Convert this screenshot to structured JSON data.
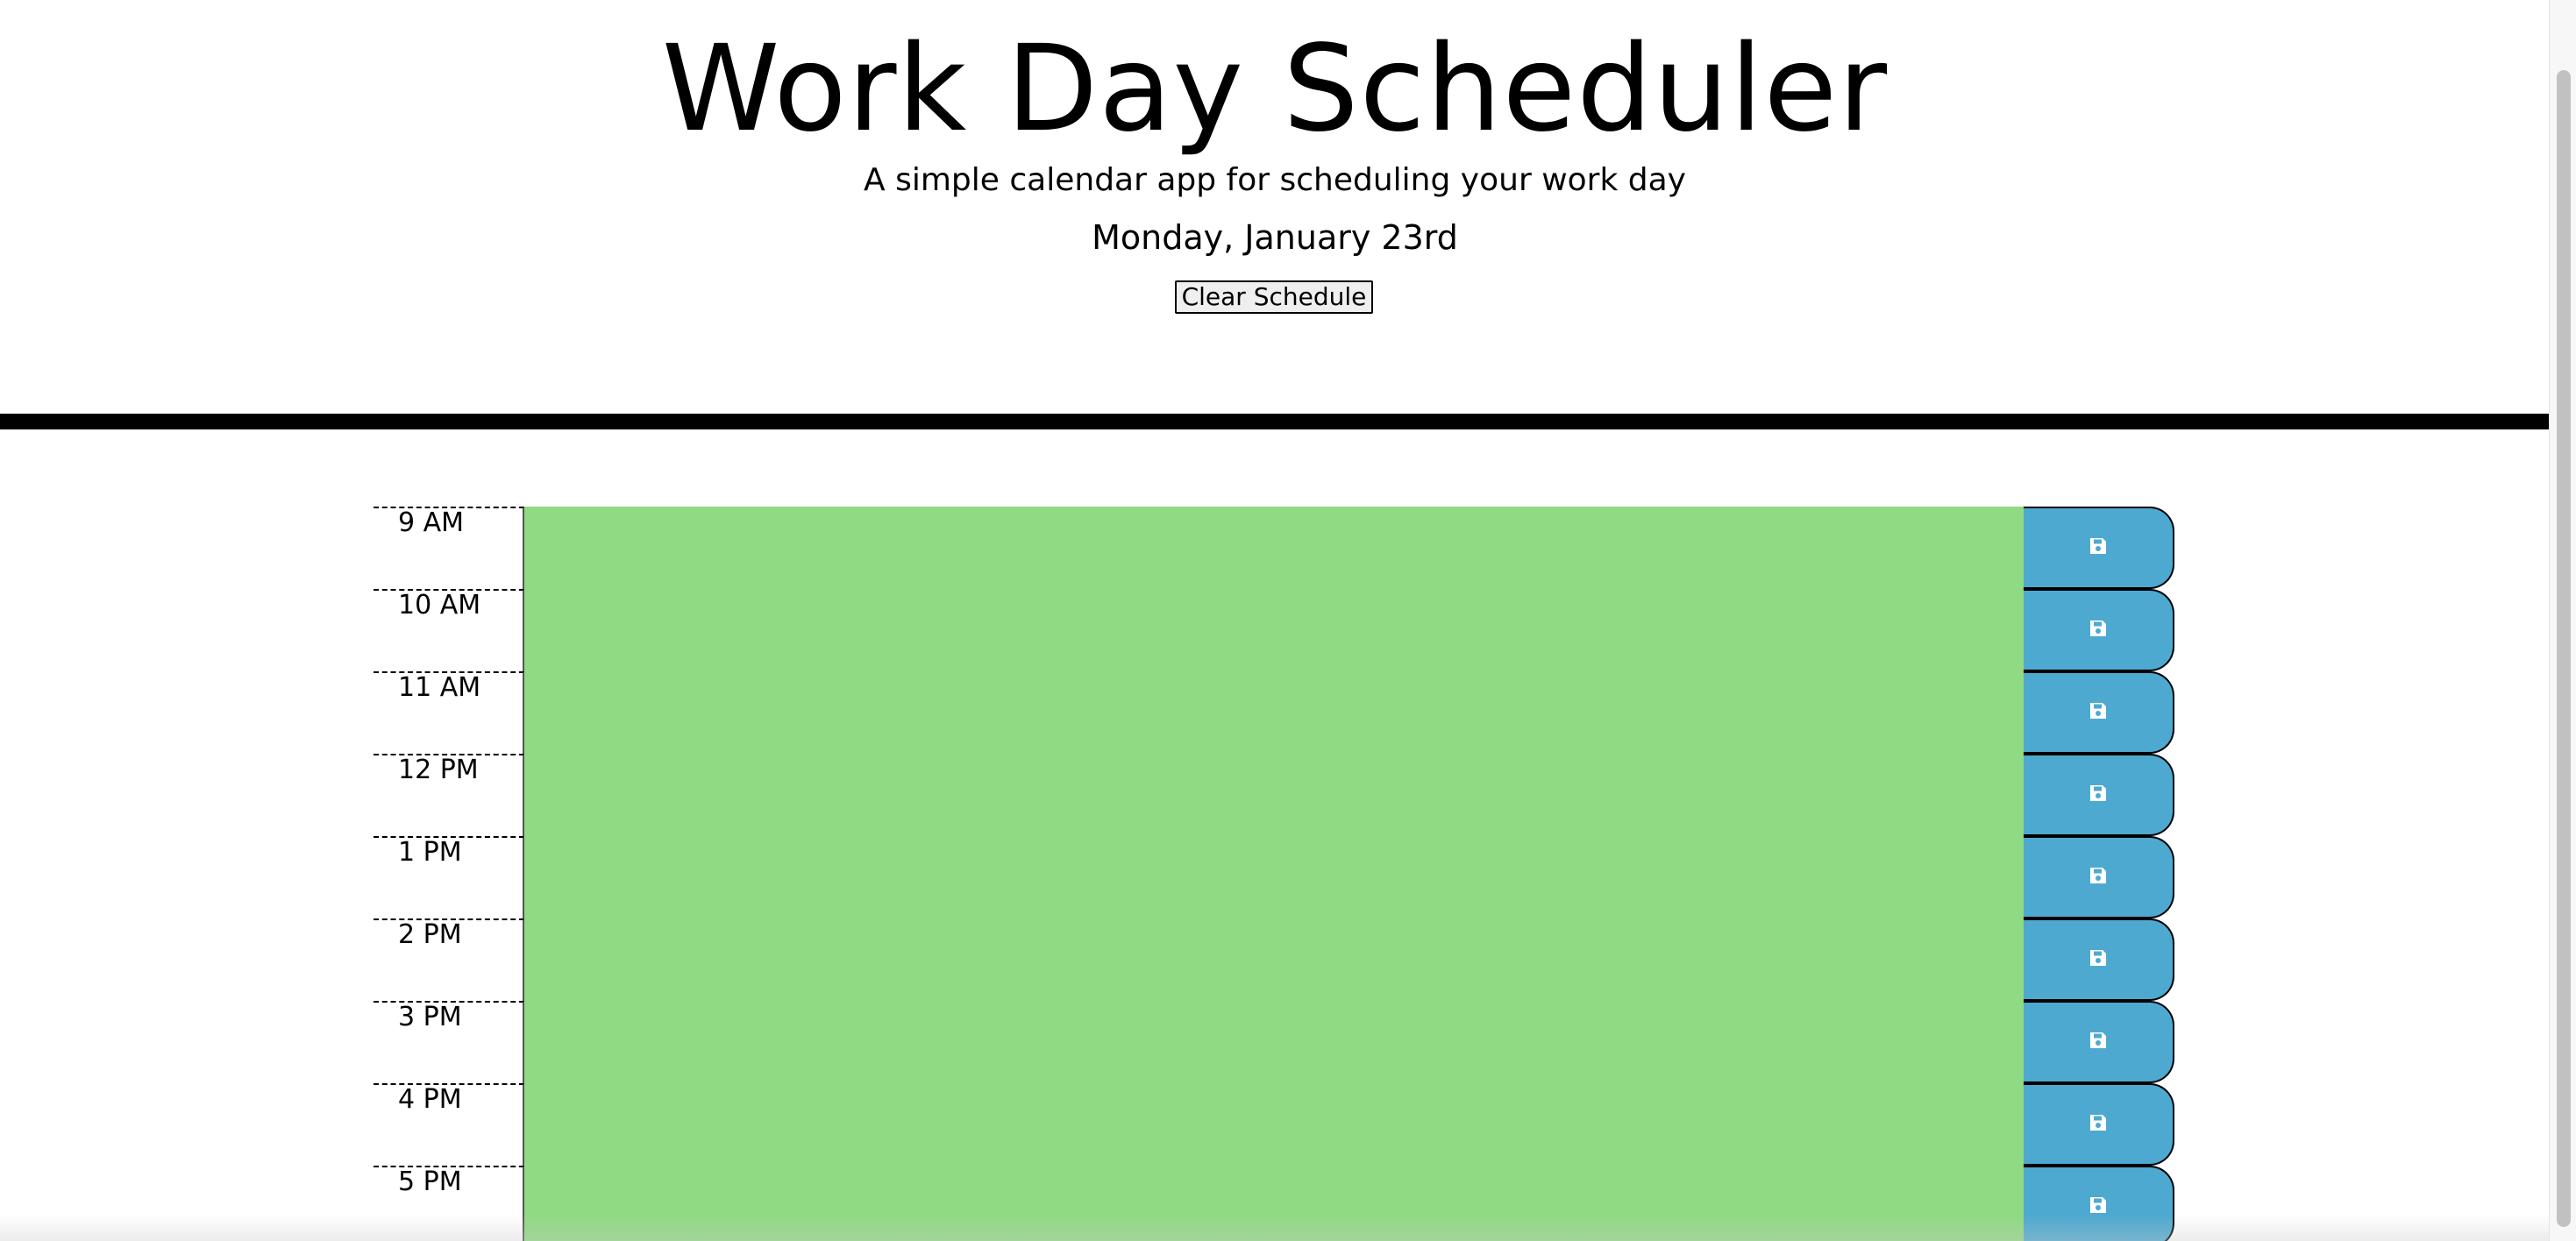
{
  "header": {
    "title": "Work Day Scheduler",
    "subtitle": "A simple calendar app for scheduling your work day",
    "current_day": "Monday, January 23rd",
    "clear_button_label": "Clear Schedule"
  },
  "colors": {
    "present_slot": "#8fda82",
    "save_button": "#4ea9d1",
    "divider": "#000000"
  },
  "save_icon": "floppy-disk-icon",
  "time_blocks": [
    {
      "hour": "9 AM",
      "text": "",
      "state": "present"
    },
    {
      "hour": "10 AM",
      "text": "",
      "state": "present"
    },
    {
      "hour": "11 AM",
      "text": "",
      "state": "present"
    },
    {
      "hour": "12 PM",
      "text": "",
      "state": "present"
    },
    {
      "hour": "1 PM",
      "text": "",
      "state": "present"
    },
    {
      "hour": "2 PM",
      "text": "",
      "state": "present"
    },
    {
      "hour": "3 PM",
      "text": "",
      "state": "present"
    },
    {
      "hour": "4 PM",
      "text": "",
      "state": "present"
    },
    {
      "hour": "5 PM",
      "text": "",
      "state": "present"
    }
  ]
}
